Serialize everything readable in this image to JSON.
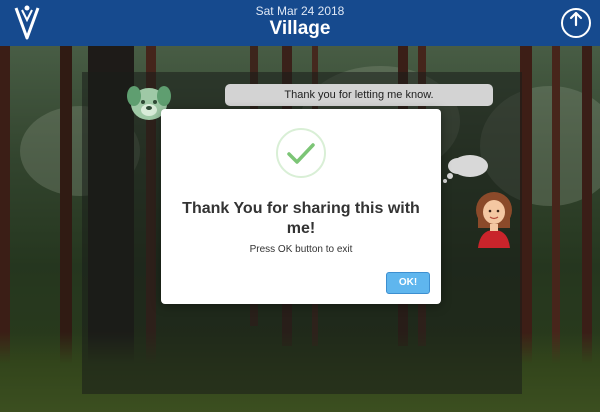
{
  "header": {
    "date": "Sat Mar 24 2018",
    "title": "Village",
    "logo_icon": "v-logo-icon",
    "power_icon": "power-icon"
  },
  "chat": {
    "incoming_message": "Thank you for letting me know.",
    "incoming_avatar": "dog-avatar",
    "outgoing_avatar": "girl-avatar"
  },
  "modal": {
    "icon": "checkmark-circle-icon",
    "title": "Thank You for sharing this with me!",
    "message": "Press OK button to exit",
    "ok_label": "OK!"
  },
  "colors": {
    "header_bg": "#164a8e",
    "check_green": "#7cc576",
    "ok_button": "#5fb6ee",
    "bubble_bg": "#d3d3d3"
  }
}
